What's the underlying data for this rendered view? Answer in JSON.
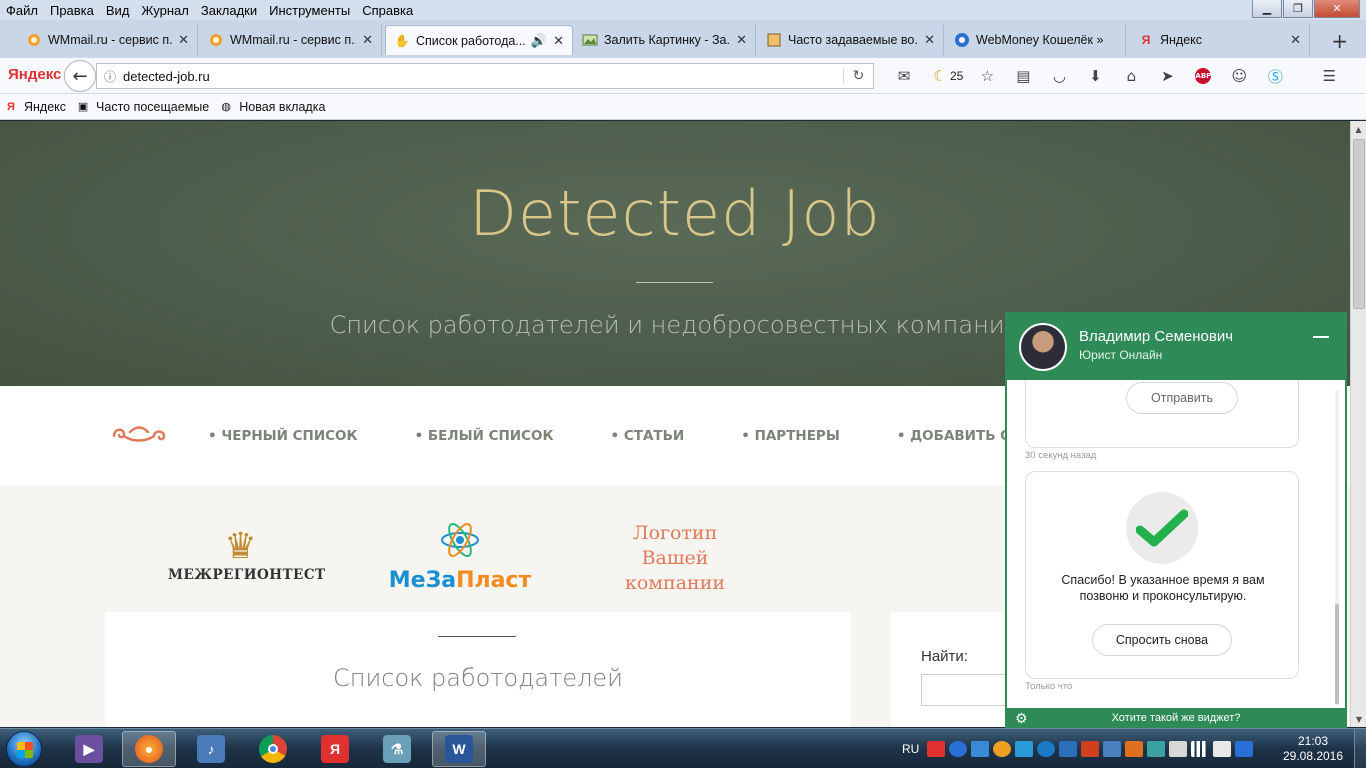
{
  "browser": {
    "menu": [
      "Файл",
      "Правка",
      "Вид",
      "Журнал",
      "Закладки",
      "Инструменты",
      "Справка"
    ],
    "tabs": [
      {
        "title": "WMmail.ru - сервис п...",
        "icon": "wmmail-icon"
      },
      {
        "title": "WMmail.ru - сервис п...",
        "icon": "wmmail-icon"
      },
      {
        "title": "Список работода...",
        "icon": "hand-icon"
      },
      {
        "title": "Залить Картинку - За...",
        "icon": "image-icon"
      },
      {
        "title": "Часто задаваемые во...",
        "icon": "faq-icon"
      },
      {
        "title": "WebMoney Кошелёк »",
        "icon": "webmoney-icon"
      },
      {
        "title": "Яндекс",
        "icon": "yandex-icon"
      }
    ],
    "yandex_logo": "Яндекс",
    "url": "detected-job.ru",
    "weather_count": "25",
    "bookmarks": [
      "Яндекс",
      "Часто посещаемые",
      "Новая вкладка"
    ]
  },
  "site": {
    "title": "Detected Job",
    "subtitle": "Список работодателей и недобросовестных компаний",
    "nav": [
      "• ЧЕРНЫЙ СПИСОК",
      "• БЕЛЫЙ СПИСОК",
      "• СТАТЬИ",
      "• ПАРТНЕРЫ",
      "• ДОБАВИТЬ ОТЗЫВ"
    ],
    "partners": {
      "logo1": "МЕЖРЕГИОНТЕСТ",
      "logo2_part1": "МеЗа",
      "logo2_part2": "Пласт",
      "logo3": [
        "Логотип",
        "Вашей",
        "компании"
      ]
    },
    "content_title": "Список работодателей",
    "search_label": "Найти:"
  },
  "chat": {
    "operator_name": "Владимир Семенович",
    "operator_role": "Юрист Онлайн",
    "send_button": "Отправить",
    "timestamp_1": "30 секунд назад",
    "thanks_message": "Спасибо! В указанное время я вам позвоню и проконсультирую.",
    "ask_again_button": "Спросить снова",
    "timestamp_2": "Только что",
    "widget_link": "Хотите такой же виджет?",
    "accent_color": "#2e8b57"
  },
  "taskbar": {
    "language": "RU",
    "time": "21:03",
    "date": "29.08.2016"
  }
}
